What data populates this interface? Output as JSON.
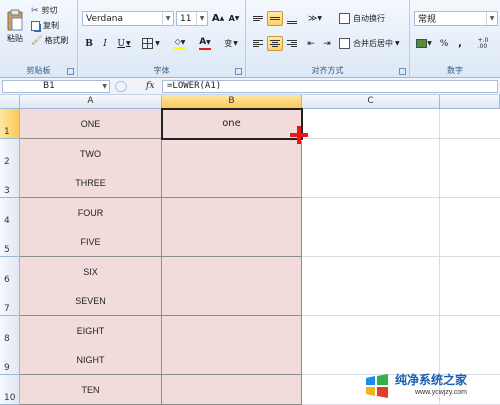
{
  "clipboard": {
    "paste_label": "粘贴",
    "cut_label": "剪切",
    "copy_label": "复制",
    "format_painter_label": "格式刷",
    "group_label": "剪贴板"
  },
  "font": {
    "font_name": "Verdana",
    "font_size": "11",
    "bold": "B",
    "italic": "I",
    "underline": "U",
    "increase_size": "A",
    "decrease_size": "A",
    "font_color_glyph": "A",
    "phonetic_glyph": "变",
    "group_label": "字体"
  },
  "alignment": {
    "wrap_text_label": "自动换行",
    "merge_center_label": "合并后居中",
    "group_label": "对齐方式"
  },
  "number": {
    "format_value": "常规",
    "percent": "%",
    "comma": ",",
    "increase_decimals": "+.0\n.00",
    "group_label": "数字"
  },
  "formula_bar": {
    "name_box": "B1",
    "fx": "fx",
    "formula": "=LOWER(A1)"
  },
  "columns": [
    "A",
    "B",
    "C"
  ],
  "rows": [
    {
      "num": "1",
      "a": "ONE",
      "b": "one"
    },
    {
      "num": "2",
      "a": "TWO",
      "b": ""
    },
    {
      "num": "3",
      "a": "THREE",
      "b": ""
    },
    {
      "num": "4",
      "a": "FOUR",
      "b": ""
    },
    {
      "num": "5",
      "a": "FIVE",
      "b": ""
    },
    {
      "num": "6",
      "a": "SIX",
      "b": ""
    },
    {
      "num": "7",
      "a": "SEVEN",
      "b": ""
    },
    {
      "num": "8",
      "a": "EIGHT",
      "b": ""
    },
    {
      "num": "9",
      "a": "NIGHT",
      "b": ""
    },
    {
      "num": "10",
      "a": "TEN",
      "b": ""
    }
  ],
  "watermark": {
    "brand": "纯净系统之家",
    "url": "www.ycwjzy.com"
  },
  "colors": {
    "cell_fill": "#f2dcdb",
    "selection_header": "#f9c957",
    "font_color_bar": "#e02020",
    "fill_color_bar": "#ffff00"
  }
}
